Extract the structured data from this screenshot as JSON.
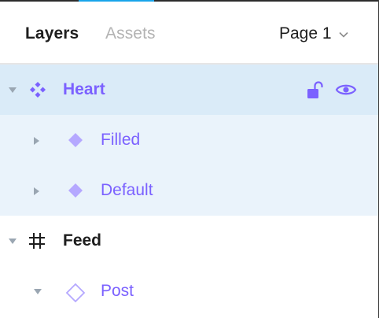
{
  "header": {
    "tabs": [
      {
        "label": "Layers",
        "active": true
      },
      {
        "label": "Assets",
        "active": false
      }
    ],
    "page_selector": {
      "label": "Page 1",
      "icon": "chevron-down-icon"
    }
  },
  "layers": [
    {
      "name": "Heart",
      "type": "component-set",
      "expanded": true,
      "selected": true,
      "indent": 0,
      "icons_right": [
        "unlock-icon",
        "eye-icon"
      ]
    },
    {
      "name": "Filled",
      "type": "component",
      "expanded": false,
      "indent": 1
    },
    {
      "name": "Default",
      "type": "component",
      "expanded": false,
      "indent": 1
    },
    {
      "name": "Feed",
      "type": "frame",
      "expanded": true,
      "indent": 0
    },
    {
      "name": "Post",
      "type": "instance",
      "expanded": true,
      "indent": 1
    }
  ],
  "colors": {
    "accent": "#19a5ea",
    "component_purple": "#7b61ff",
    "selection": "#daebf8",
    "selection_child": "#eaf3fb"
  }
}
